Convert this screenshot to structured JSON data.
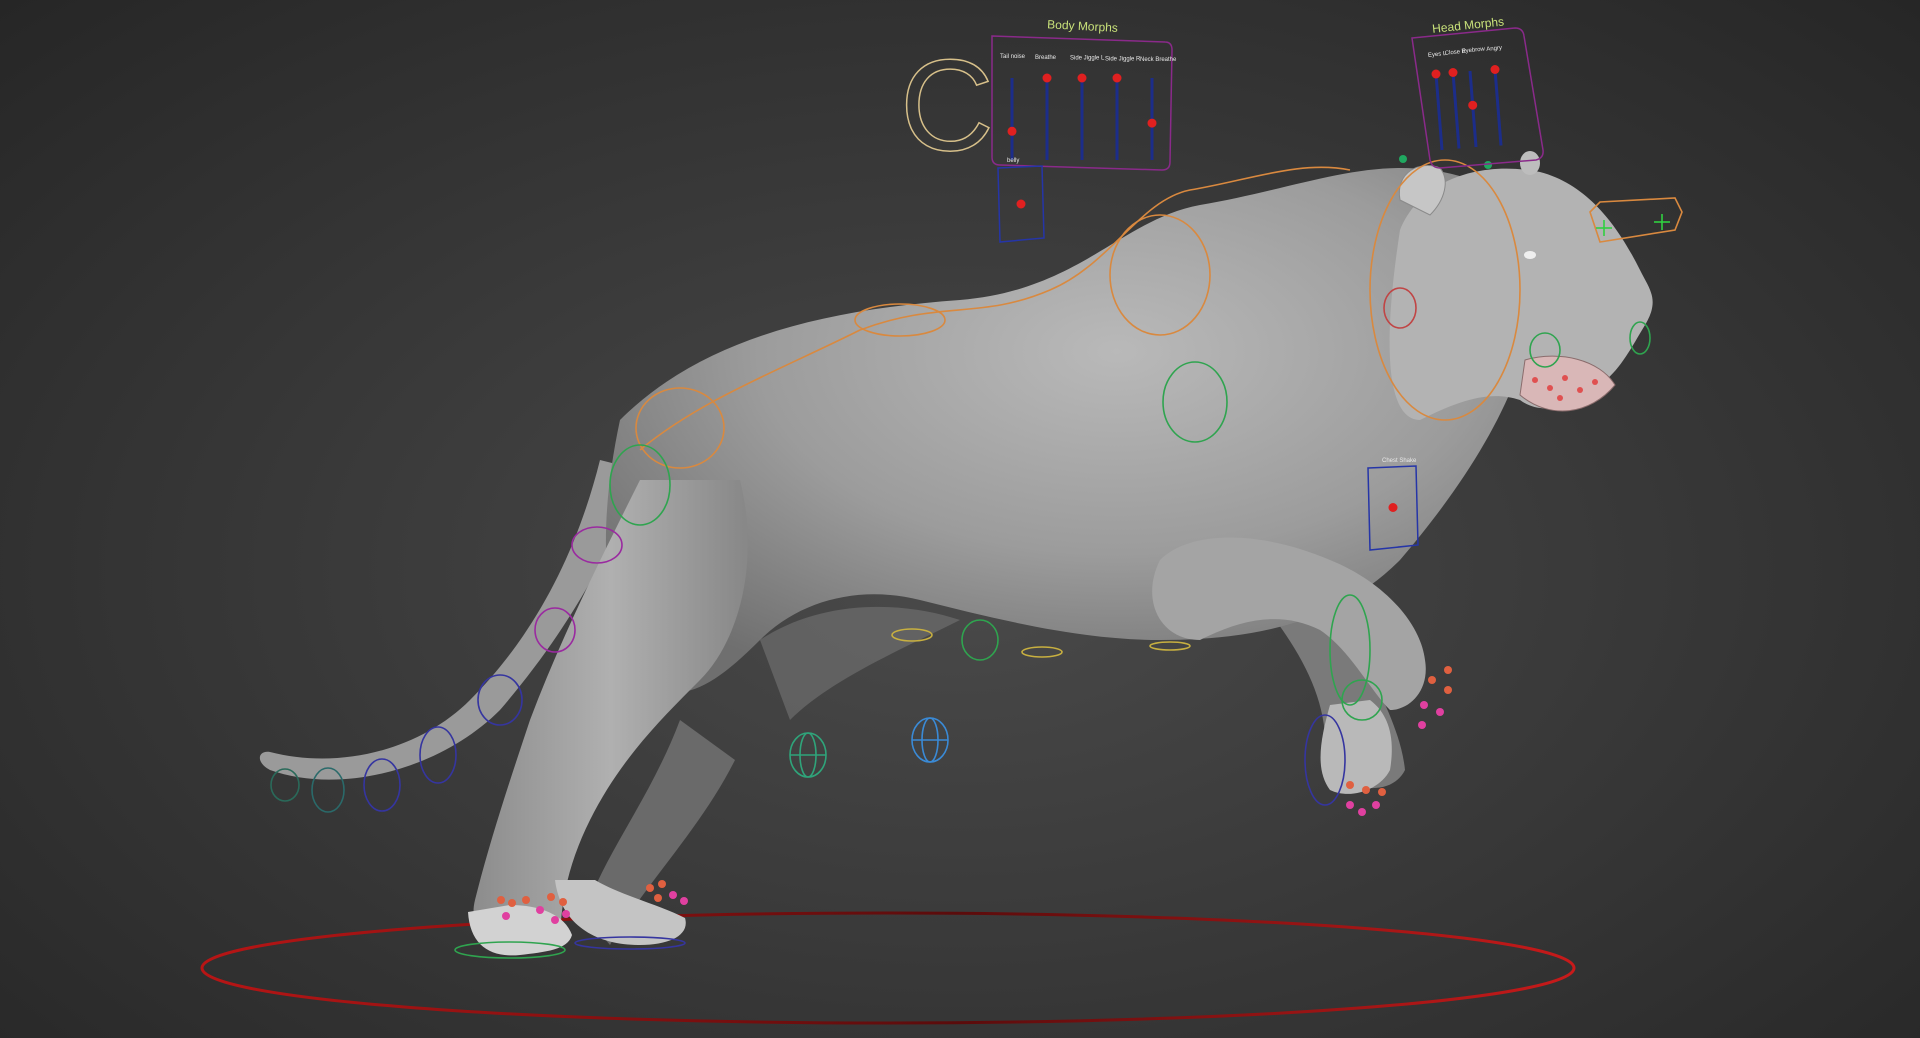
{
  "body_morphs": {
    "title": "Body Morphs",
    "sliders": [
      {
        "label": "Tail noise",
        "value": 0.35
      },
      {
        "label": "Breathe",
        "value": 1.0
      },
      {
        "label": "Side Jiggle L",
        "value": 1.0
      },
      {
        "label": "Side Jiggle R",
        "value": 1.0
      },
      {
        "label": "Neck Breathe",
        "value": 0.45
      }
    ],
    "belly_label": "belly",
    "belly_value": 0.5
  },
  "head_morphs": {
    "title": "Head Morphs",
    "sliders": [
      {
        "label": "Eyes L",
        "value": 1.0
      },
      {
        "label": "Close R",
        "value": 1.0
      },
      {
        "label": "Eyebrow",
        "value": 0.55
      },
      {
        "label": "Angry",
        "value": 1.0
      }
    ]
  },
  "chest_shake": {
    "label": "Chest Shake",
    "value": 0.5
  },
  "master_control_letter": "C",
  "colors": {
    "background": "#3a3a3a",
    "mesh": "#a8a8a8",
    "morph_frame": "#8a2a8a",
    "slider_track": "#1c2d8a",
    "slider_knob": "#e02020",
    "title_text": "#c9e27a",
    "ground_circle": "#c01818",
    "spine_ctrl": "#d58a4a",
    "leg_ctrl": "#2fa44f",
    "tail_ctrl": "#2a2a9a"
  }
}
